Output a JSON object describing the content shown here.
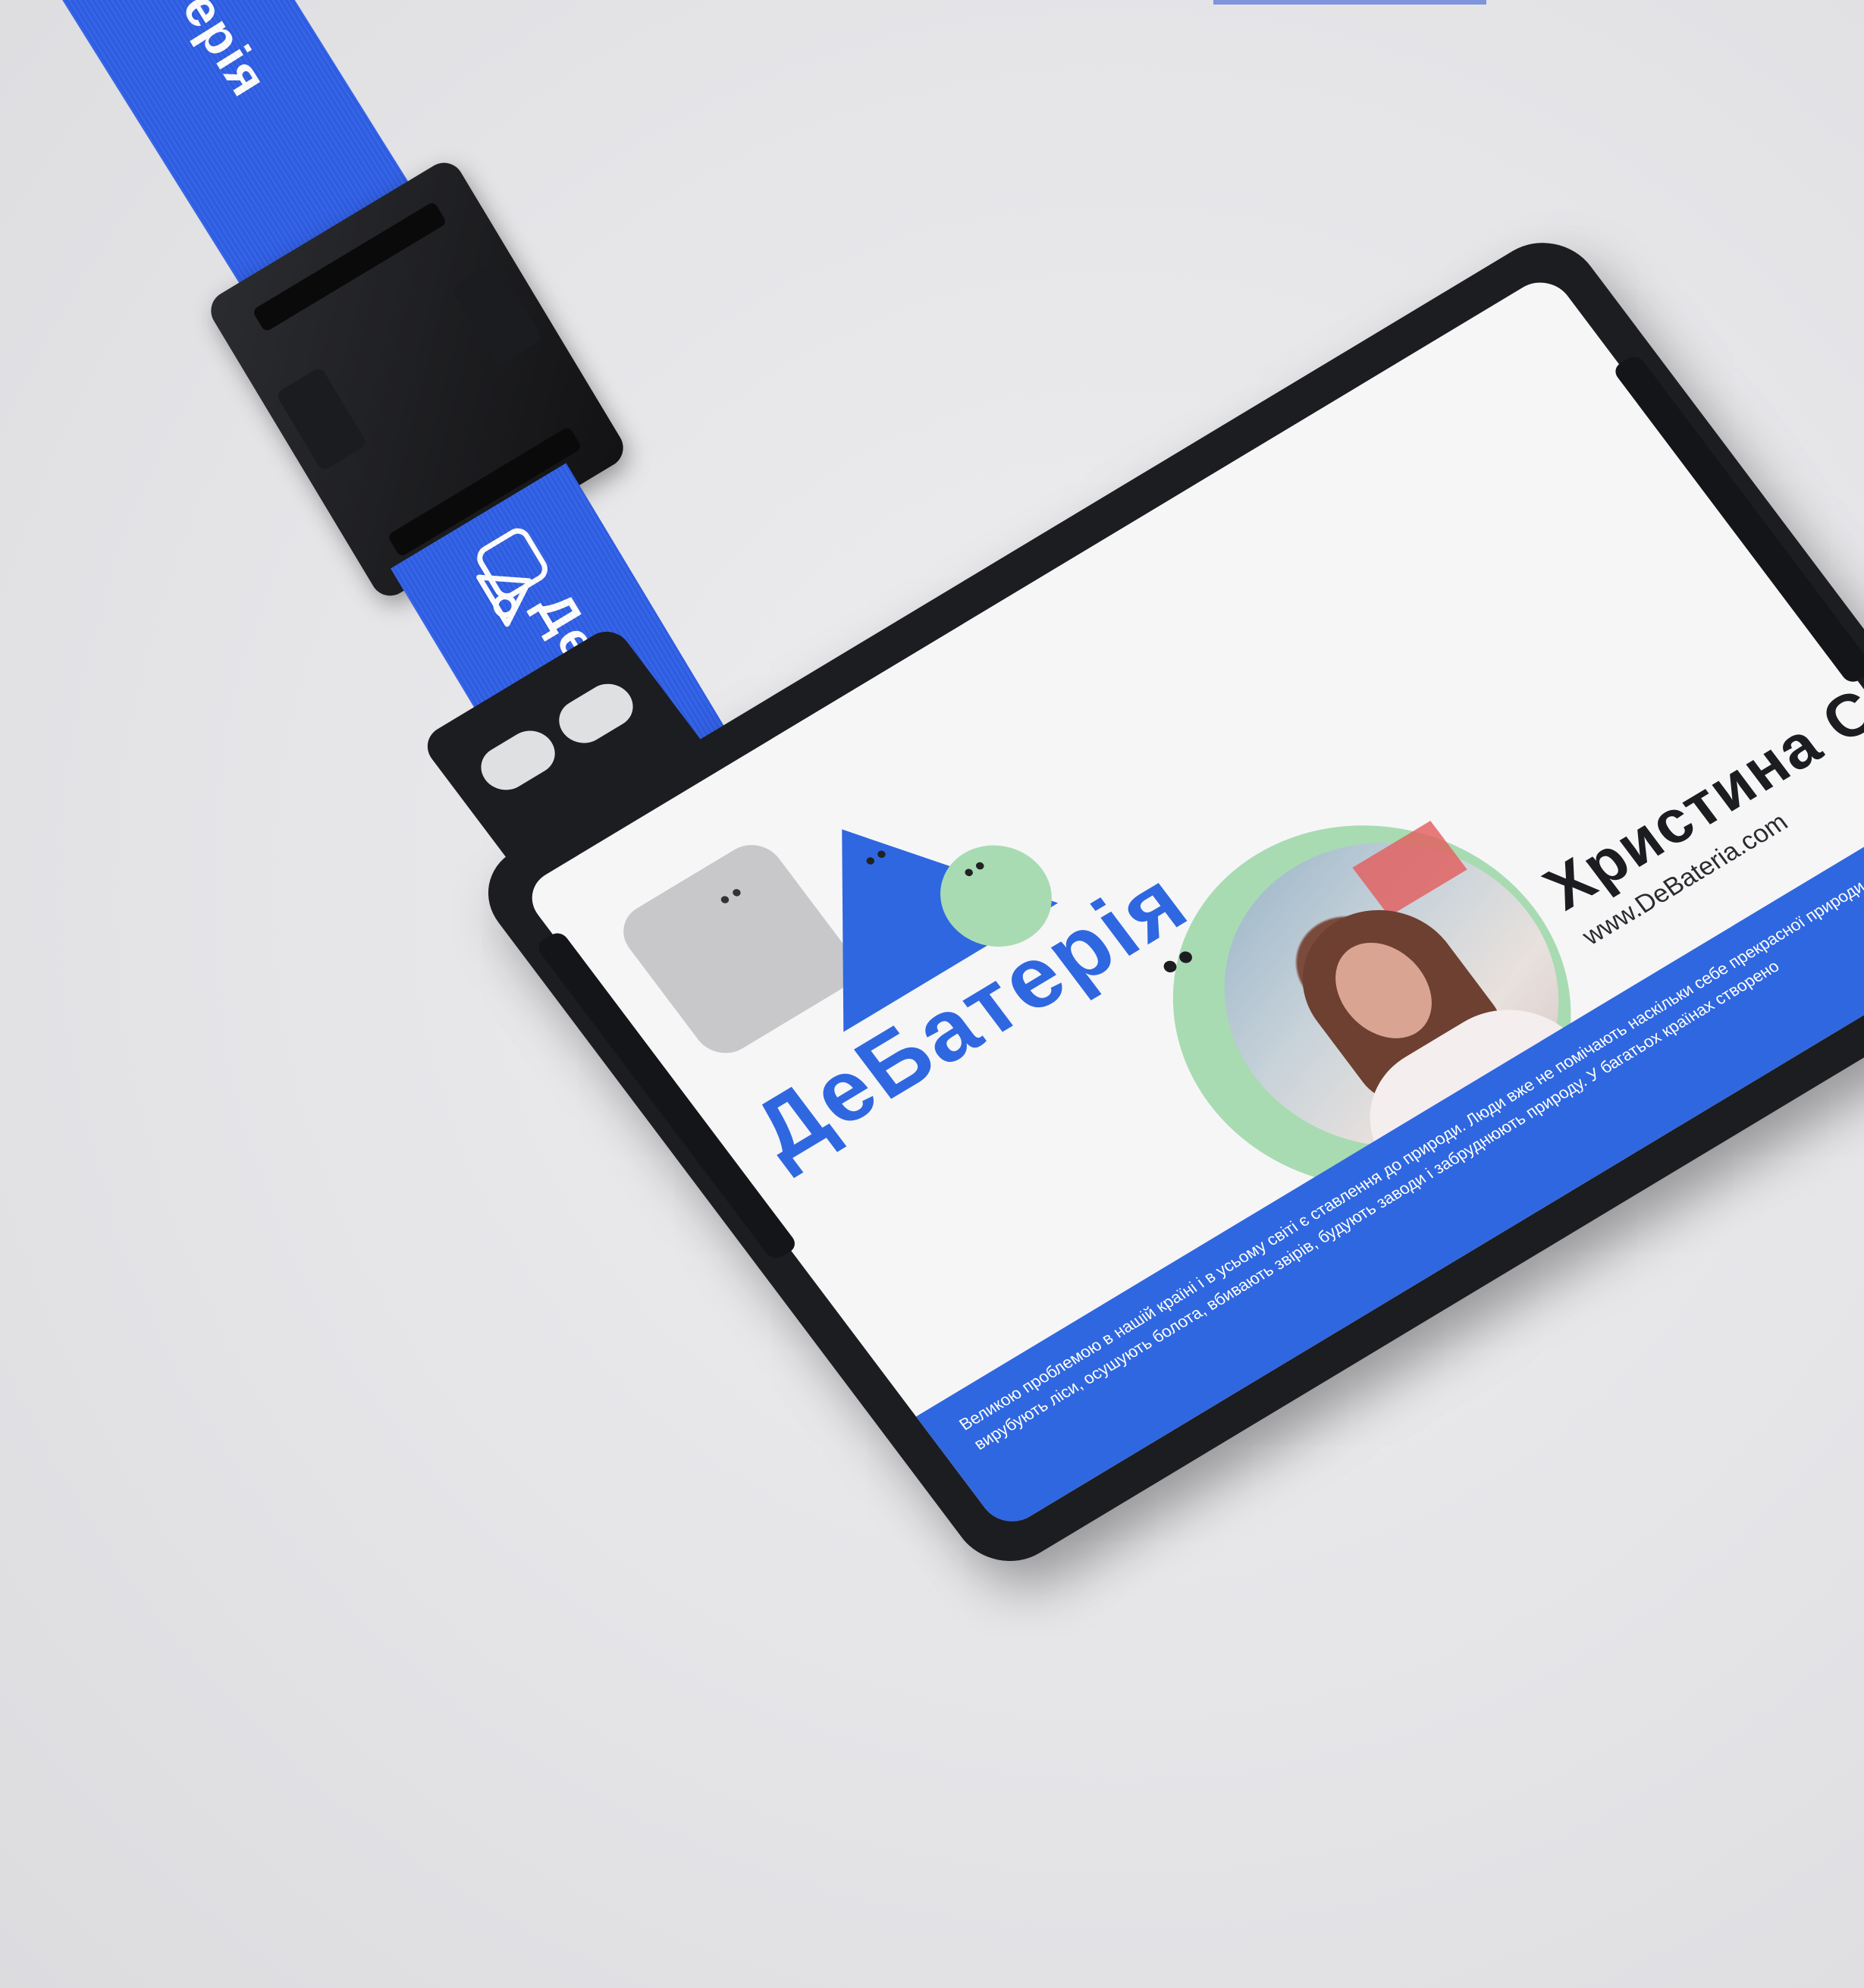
{
  "lanyard": {
    "strap_text_upper": "ДеБатерія",
    "strap_text_lower": "ДеБатерія",
    "strap_color": "#2f5fe6"
  },
  "card": {
    "brand": "ДеБатерія",
    "name": "Христина Степан",
    "website": "www.DeBateria.com",
    "footer_text": "Великою проблемою в нашій країні і в усьому світі є ставлення до природи. Люди вже не помічають наскільки себе прекрасної природи, вони вирубують ліси, осушують болота, вбивають звірів, будують заводи і забруднюють природу. У багатьох країнах створено",
    "colors": {
      "brand_blue": "#2f67e0",
      "logo_grey": "#c8c8cb",
      "logo_green": "#a8dbb2",
      "holder_black": "#1c1d21"
    }
  },
  "icons": {
    "strap_logo": "battery-logo-icon",
    "card_logo": "battery-logo-icon"
  }
}
